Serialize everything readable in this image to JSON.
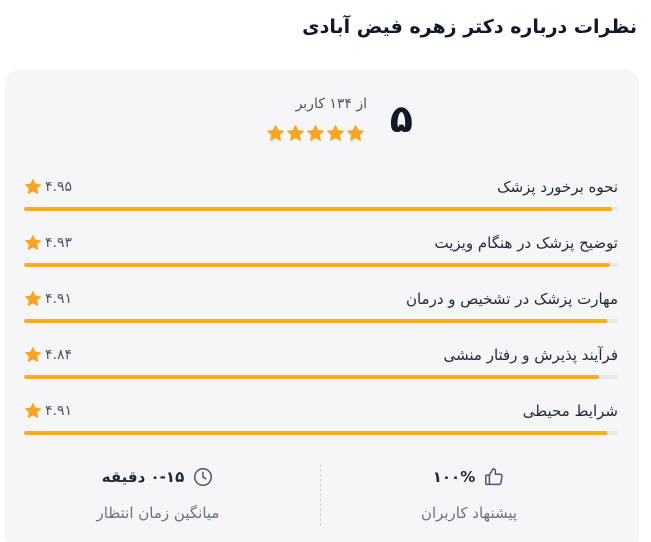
{
  "page": {
    "title": "نظرات درباره دکتر زهره فیض آبادی"
  },
  "summary": {
    "score": "۵",
    "count_text": "از ۱۳۴ کاربر",
    "stars": 5
  },
  "metrics": [
    {
      "label": "نحوه برخورد پزشک",
      "value_text": "۴.۹۵",
      "value": 4.95
    },
    {
      "label": "توضیح پزشک در هنگام ویزیت",
      "value_text": "۴.۹۳",
      "value": 4.93
    },
    {
      "label": "مهارت پزشک در تشخیص و درمان",
      "value_text": "۴.۹۱",
      "value": 4.91
    },
    {
      "label": "فرآیند پذیرش و رفتار منشی",
      "value_text": "۴.۸۴",
      "value": 4.84
    },
    {
      "label": "شرایط محیطی",
      "value_text": "۴.۹۱",
      "value": 4.91
    }
  ],
  "metric_max": 5,
  "footer": {
    "recommend": {
      "value": "۱۰۰%",
      "label": "پیشنهاد کاربران",
      "icon": "thumbs-up-icon"
    },
    "wait": {
      "value": "۰-۱۵ دقیقه",
      "label": "میانگین زمان انتظار",
      "icon": "clock-icon"
    }
  },
  "colors": {
    "star": "#f6a623",
    "bar_fill": "#f6b01e",
    "bar_track": "#e5e7eb",
    "card_bg": "#f6f6f8"
  }
}
